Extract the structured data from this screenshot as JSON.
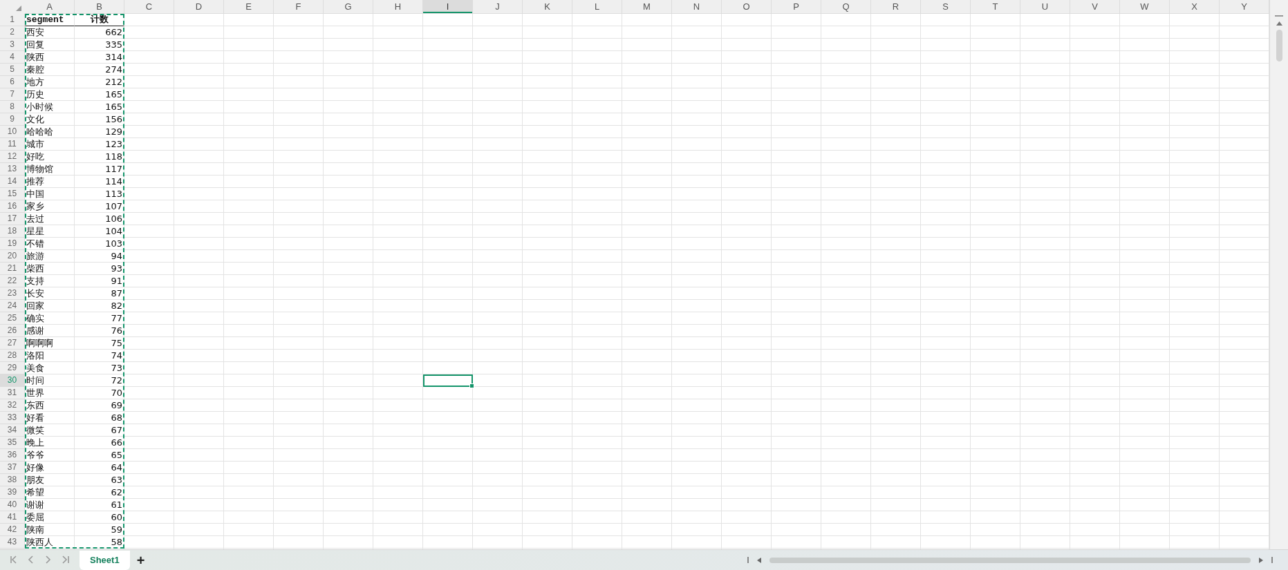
{
  "columns": [
    {
      "label": "A",
      "selected": false
    },
    {
      "label": "B",
      "selected": false
    },
    {
      "label": "C",
      "selected": false
    },
    {
      "label": "D",
      "selected": false
    },
    {
      "label": "E",
      "selected": false
    },
    {
      "label": "F",
      "selected": false
    },
    {
      "label": "G",
      "selected": false
    },
    {
      "label": "H",
      "selected": false
    },
    {
      "label": "I",
      "selected": true
    },
    {
      "label": "J",
      "selected": false
    },
    {
      "label": "K",
      "selected": false
    },
    {
      "label": "L",
      "selected": false
    },
    {
      "label": "M",
      "selected": false
    },
    {
      "label": "N",
      "selected": false
    },
    {
      "label": "O",
      "selected": false
    },
    {
      "label": "P",
      "selected": false
    },
    {
      "label": "Q",
      "selected": false
    },
    {
      "label": "R",
      "selected": false
    },
    {
      "label": "S",
      "selected": false
    },
    {
      "label": "T",
      "selected": false
    },
    {
      "label": "U",
      "selected": false
    },
    {
      "label": "V",
      "selected": false
    },
    {
      "label": "W",
      "selected": false
    },
    {
      "label": "X",
      "selected": false
    },
    {
      "label": "Y",
      "selected": false
    }
  ],
  "copied_range_marked": true,
  "rows": [
    {
      "number": "1",
      "kind": "header",
      "selected": false,
      "cells": [
        "segment",
        "计数"
      ]
    },
    {
      "number": "2",
      "kind": "data",
      "selected": false,
      "cells": [
        "西安",
        "662"
      ]
    },
    {
      "number": "3",
      "kind": "data",
      "selected": false,
      "cells": [
        "回复",
        "335"
      ]
    },
    {
      "number": "4",
      "kind": "data",
      "selected": false,
      "cells": [
        "陕西",
        "314"
      ]
    },
    {
      "number": "5",
      "kind": "data",
      "selected": false,
      "cells": [
        "秦腔",
        "274"
      ]
    },
    {
      "number": "6",
      "kind": "data",
      "selected": false,
      "cells": [
        "地方",
        "212"
      ]
    },
    {
      "number": "7",
      "kind": "data",
      "selected": false,
      "cells": [
        "历史",
        "165"
      ]
    },
    {
      "number": "8",
      "kind": "data",
      "selected": false,
      "cells": [
        "小时候",
        "165"
      ]
    },
    {
      "number": "9",
      "kind": "data",
      "selected": false,
      "cells": [
        "文化",
        "156"
      ]
    },
    {
      "number": "10",
      "kind": "data",
      "selected": false,
      "cells": [
        "哈哈哈",
        "129"
      ]
    },
    {
      "number": "11",
      "kind": "data",
      "selected": false,
      "cells": [
        "城市",
        "123"
      ]
    },
    {
      "number": "12",
      "kind": "data",
      "selected": false,
      "cells": [
        "好吃",
        "118"
      ]
    },
    {
      "number": "13",
      "kind": "data",
      "selected": false,
      "cells": [
        "博物馆",
        "117"
      ]
    },
    {
      "number": "14",
      "kind": "data",
      "selected": false,
      "cells": [
        "推荐",
        "114"
      ]
    },
    {
      "number": "15",
      "kind": "data",
      "selected": false,
      "cells": [
        "中国",
        "113"
      ]
    },
    {
      "number": "16",
      "kind": "data",
      "selected": false,
      "cells": [
        "家乡",
        "107"
      ]
    },
    {
      "number": "17",
      "kind": "data",
      "selected": false,
      "cells": [
        "去过",
        "106"
      ]
    },
    {
      "number": "18",
      "kind": "data",
      "selected": false,
      "cells": [
        "星星",
        "104"
      ]
    },
    {
      "number": "19",
      "kind": "data",
      "selected": false,
      "cells": [
        "不错",
        "103"
      ]
    },
    {
      "number": "20",
      "kind": "data",
      "selected": false,
      "cells": [
        "旅游",
        "94"
      ]
    },
    {
      "number": "21",
      "kind": "data",
      "selected": false,
      "cells": [
        "柴西",
        "93"
      ]
    },
    {
      "number": "22",
      "kind": "data",
      "selected": false,
      "cells": [
        "支持",
        "91"
      ]
    },
    {
      "number": "23",
      "kind": "data",
      "selected": false,
      "cells": [
        "长安",
        "87"
      ]
    },
    {
      "number": "24",
      "kind": "data",
      "selected": false,
      "cells": [
        "回家",
        "82"
      ]
    },
    {
      "number": "25",
      "kind": "data",
      "selected": false,
      "cells": [
        "确实",
        "77"
      ]
    },
    {
      "number": "26",
      "kind": "data",
      "selected": false,
      "cells": [
        "感谢",
        "76"
      ]
    },
    {
      "number": "27",
      "kind": "data",
      "selected": false,
      "cells": [
        "啊啊啊",
        "75"
      ]
    },
    {
      "number": "28",
      "kind": "data",
      "selected": false,
      "cells": [
        "洛阳",
        "74"
      ]
    },
    {
      "number": "29",
      "kind": "data",
      "selected": false,
      "cells": [
        "美食",
        "73"
      ]
    },
    {
      "number": "30",
      "kind": "data",
      "selected": true,
      "cells": [
        "时间",
        "72"
      ]
    },
    {
      "number": "31",
      "kind": "data",
      "selected": false,
      "cells": [
        "世界",
        "70"
      ]
    },
    {
      "number": "32",
      "kind": "data",
      "selected": false,
      "cells": [
        "东西",
        "69"
      ]
    },
    {
      "number": "33",
      "kind": "data",
      "selected": false,
      "cells": [
        "好看",
        "68"
      ]
    },
    {
      "number": "34",
      "kind": "data",
      "selected": false,
      "cells": [
        "微笑",
        "67"
      ]
    },
    {
      "number": "35",
      "kind": "data",
      "selected": false,
      "cells": [
        "晚上",
        "66"
      ]
    },
    {
      "number": "36",
      "kind": "data",
      "selected": false,
      "cells": [
        "爷爷",
        "65"
      ]
    },
    {
      "number": "37",
      "kind": "data",
      "selected": false,
      "cells": [
        "好像",
        "64"
      ]
    },
    {
      "number": "38",
      "kind": "data",
      "selected": false,
      "cells": [
        "朋友",
        "63"
      ]
    },
    {
      "number": "39",
      "kind": "data",
      "selected": false,
      "cells": [
        "希望",
        "62"
      ]
    },
    {
      "number": "40",
      "kind": "data",
      "selected": false,
      "cells": [
        "谢谢",
        "61"
      ]
    },
    {
      "number": "41",
      "kind": "data",
      "selected": false,
      "cells": [
        "委屈",
        "60"
      ]
    },
    {
      "number": "42",
      "kind": "data",
      "selected": false,
      "cells": [
        "陕南",
        "59"
      ]
    },
    {
      "number": "43",
      "kind": "data",
      "selected": false,
      "cells": [
        "陕西人",
        "58"
      ]
    }
  ],
  "sheet_tabs": [
    {
      "label": "Sheet1",
      "selected": true
    }
  ],
  "add_sheet": "+"
}
